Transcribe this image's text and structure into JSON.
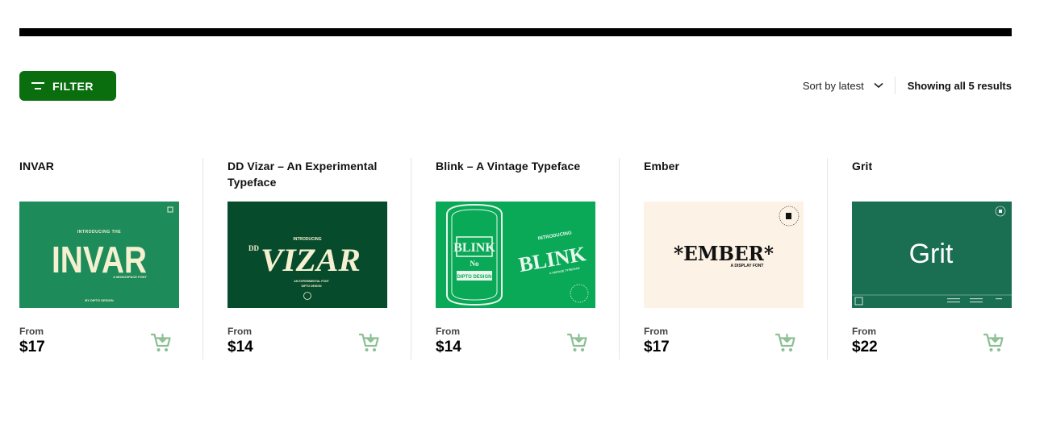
{
  "toolbar": {
    "filter_label": "FILTER",
    "sort_label": "Sort by latest",
    "results_text": "Showing all 5 results"
  },
  "colors": {
    "brand_green": "#0a6e0f",
    "cart_icon": "#8cbf94",
    "top_bar": "#000000"
  },
  "products": [
    {
      "title": "INVAR",
      "price_prefix": "From",
      "price": "$17",
      "thumb": {
        "intro": "INTRODUCING THE",
        "name": "INVAR",
        "tagline": "A MONOSPACE FONT",
        "credit": "BY DIPTO DESIGN",
        "bg": "#1e8c5a",
        "fg": "#f4f0d0"
      }
    },
    {
      "title": "DD Vizar – An Experimental Typeface",
      "price_prefix": "From",
      "price": "$14",
      "thumb": {
        "intro": "INTRODUCING",
        "prefix": "DD",
        "name": "VIZAR",
        "tagline": "AN EXPERIMENTAL FONT",
        "credit": "DIPTO DESIGN",
        "bg": "#064b2c",
        "fg": "#f4f0d0"
      }
    },
    {
      "title": "Blink – A Vintage Typeface",
      "price_prefix": "From",
      "price": "$14",
      "thumb": {
        "intro": "INTRODUCING",
        "name": "BLINK",
        "tagline": "A VINTAGE TYPEFACE",
        "badge_name": "BLINK",
        "badge_no": "No",
        "badge_credit": "DIPTO DESIGN",
        "bg": "#0aa958",
        "fg": "#e9f7ec"
      }
    },
    {
      "title": "Ember",
      "price_prefix": "From",
      "price": "$17",
      "thumb": {
        "name": "*EMBER*",
        "tagline": "A DISPLAY FONT",
        "bg": "#fdf2e6",
        "fg": "#111111"
      }
    },
    {
      "title": "Grit",
      "price_prefix": "From",
      "price": "$22",
      "thumb": {
        "name": "Grit",
        "bg": "#1a6e52",
        "fg": "#ffffff"
      }
    }
  ]
}
